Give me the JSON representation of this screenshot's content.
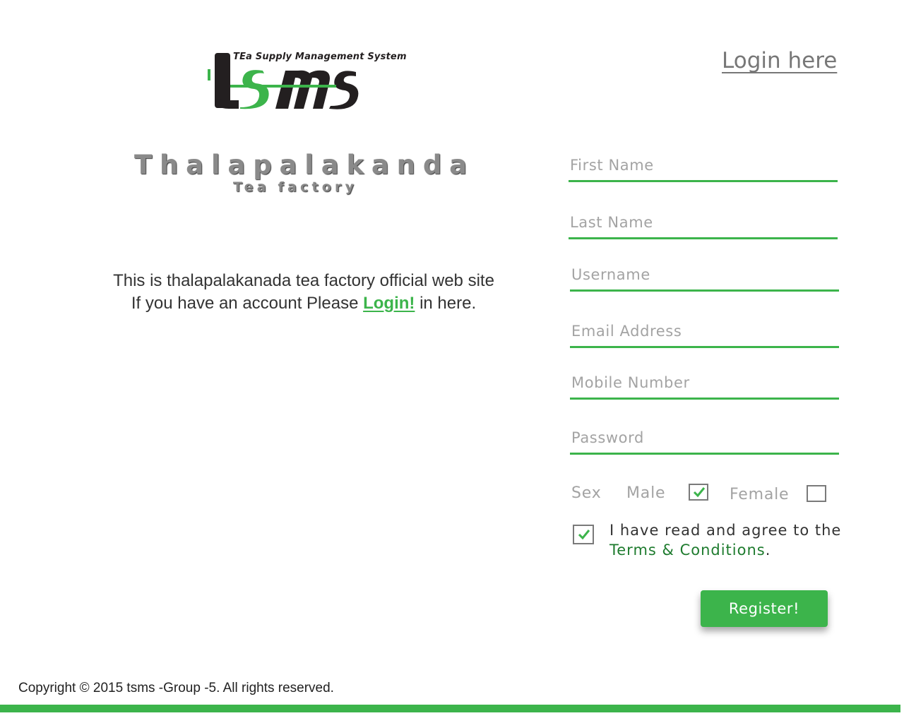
{
  "header": {
    "logo_tagline": "TEa Supply Management System",
    "logo_text": "tsms",
    "login_here_label": "Login here"
  },
  "brand": {
    "factory_name": "Thalapalakanda",
    "factory_sub": "Tea factory"
  },
  "intro": {
    "line1": "This is thalapalakanada tea factory official web site",
    "line2_before": "If you have an account Please ",
    "line2_link": "Login!",
    "line2_after": " in here."
  },
  "form": {
    "first_name_placeholder": "First Name",
    "last_name_placeholder": "Last Name",
    "username_placeholder": "Username",
    "email_placeholder": "Email Address",
    "mobile_placeholder": "Mobile Number",
    "password_placeholder": "Password",
    "sex_label": "Sex",
    "male_label": "Male",
    "male_checked": true,
    "female_label": "Female",
    "female_checked": false,
    "agree_checked": true,
    "terms_before": "I have read and agree to the ",
    "terms_link": "Terms & Conditions",
    "terms_after": ".",
    "register_label": "Register!"
  },
  "footer": {
    "copyright": "Copyright © 2015 tsms -Group -5. All rights reserved."
  },
  "colors": {
    "accent": "#3cb44b",
    "accent_dark": "#1e7b2e",
    "muted_text": "#a3a3a3",
    "logo_dark": "#231f20"
  }
}
